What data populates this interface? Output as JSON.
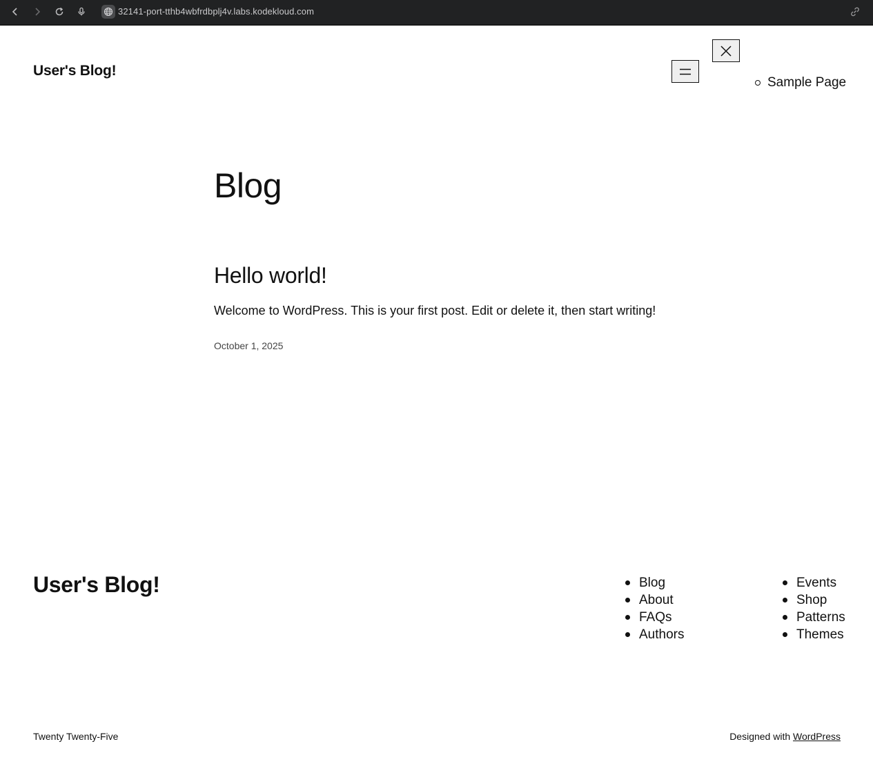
{
  "browser": {
    "url": "32141-port-tthb4wbfrdbplj4v.labs.kodekloud.com"
  },
  "header": {
    "site_title": "User's Blog!",
    "nav_items": [
      "Sample Page"
    ]
  },
  "main": {
    "page_title": "Blog",
    "posts": [
      {
        "title": "Hello world!",
        "excerpt": "Welcome to WordPress. This is your first post. Edit or delete it, then start writing!",
        "date": "October 1, 2025"
      }
    ]
  },
  "footer": {
    "site_title": "User's Blog!",
    "nav_col_1": [
      "Blog",
      "About",
      "FAQs",
      "Authors"
    ],
    "nav_col_2": [
      "Events",
      "Shop",
      "Patterns",
      "Themes"
    ],
    "theme_credit": "Twenty Twenty-Five",
    "designed_with_prefix": "Designed with ",
    "designed_with_link": "WordPress"
  }
}
